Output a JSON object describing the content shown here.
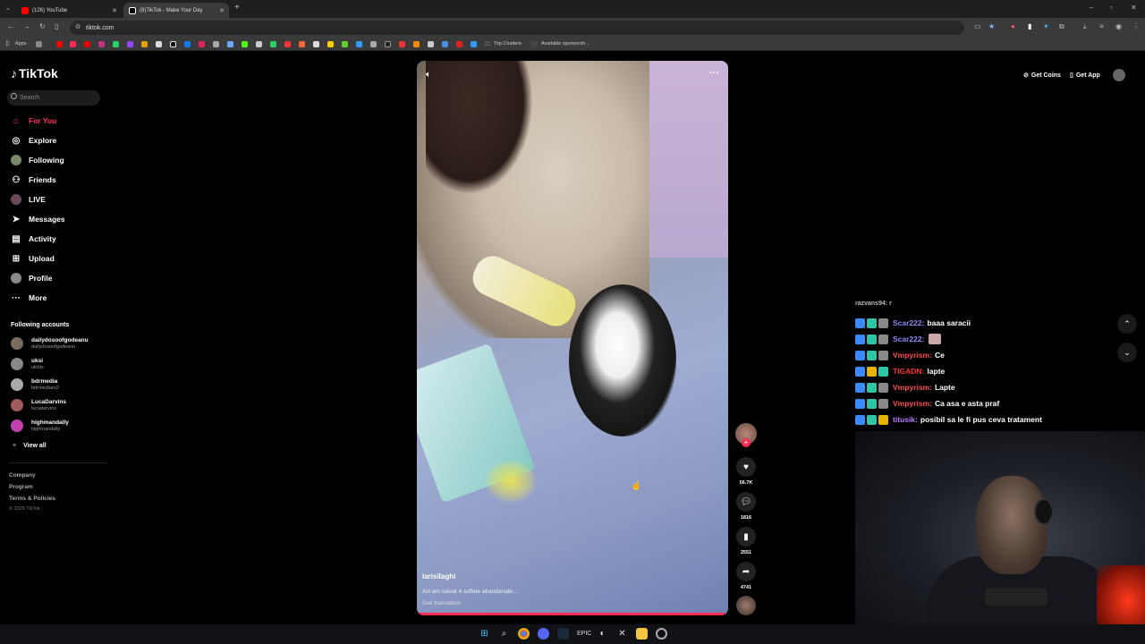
{
  "browser": {
    "tabs": [
      {
        "label": "(126) YouTube",
        "color": "#ff0000"
      },
      {
        "label": "(8)TikTok - Make Your Day",
        "color": "#ffffff"
      }
    ],
    "url": "tiktok.com",
    "bookmarks": {
      "apps": "Apps",
      "top_chatters": "Top Chatters",
      "available": "Available sponsorsh..."
    }
  },
  "sidebar": {
    "logo": "TikTok",
    "search_placeholder": "Search",
    "nav": [
      {
        "label": "For You",
        "icon": "home-icon"
      },
      {
        "label": "Explore",
        "icon": "compass-icon"
      },
      {
        "label": "Following",
        "icon": "following-avatar-icon"
      },
      {
        "label": "Friends",
        "icon": "friends-icon"
      },
      {
        "label": "LIVE",
        "icon": "live-icon"
      },
      {
        "label": "Messages",
        "icon": "send-icon"
      },
      {
        "label": "Activity",
        "icon": "activity-icon"
      },
      {
        "label": "Upload",
        "icon": "upload-icon"
      },
      {
        "label": "Profile",
        "icon": "profile-avatar-icon"
      },
      {
        "label": "More",
        "icon": "more-dots-icon"
      }
    ],
    "following_header": "Following accounts",
    "accounts": [
      {
        "name": "dailydosoofgodeanu",
        "handle": "dailydosoofgodeanu",
        "color": "#7a6a5d"
      },
      {
        "name": "uksi",
        "handle": "uklsis",
        "color": "#888888"
      },
      {
        "name": "bdrmedia",
        "handle": "bdrmediaro2",
        "color": "#aaaaaa"
      },
      {
        "name": "LucaDarvins",
        "handle": "lucadarvins",
        "color": "#a05a5a"
      },
      {
        "name": "highmandally",
        "handle": "highmandally",
        "color": "#c040b0"
      }
    ],
    "view_all": "View all",
    "footer": [
      "Company",
      "Program",
      "Terms & Policies"
    ],
    "copyright": "© 2026 TikTok"
  },
  "topright": {
    "coins": "Get Coins",
    "app": "Get App"
  },
  "video": {
    "username": "larisilaghi",
    "description": "Azi am salvat 4 suflete abandonate ...",
    "see_translation": "See translation",
    "progress": 0.99,
    "more": "···"
  },
  "rail": {
    "likes": "56.7K",
    "comments": "1816",
    "saves": "2551",
    "shares": "4741"
  },
  "chat": {
    "partial_top": "razvans94: r",
    "lines": [
      {
        "user": "Scar222:",
        "msg": "baaa saracii",
        "color": "#8a8af0"
      },
      {
        "user": "Scar222:",
        "msg": "",
        "color": "#8a8af0"
      },
      {
        "user": "Vmpyrism:",
        "msg": "Ce",
        "color": "#ff4d4d"
      },
      {
        "user": "TIGADN:",
        "msg": "lapte",
        "color": "#ff2a2a"
      },
      {
        "user": "Vmpyrism:",
        "msg": "Lapte",
        "color": "#ff4d4d"
      },
      {
        "user": "Vmpyrism:",
        "msg": "Ca asa e asta praf",
        "color": "#ff4d4d"
      },
      {
        "user": "titusik:",
        "msg": "posibil sa le fi pus ceva tratament",
        "color": "#b87aff"
      }
    ]
  }
}
